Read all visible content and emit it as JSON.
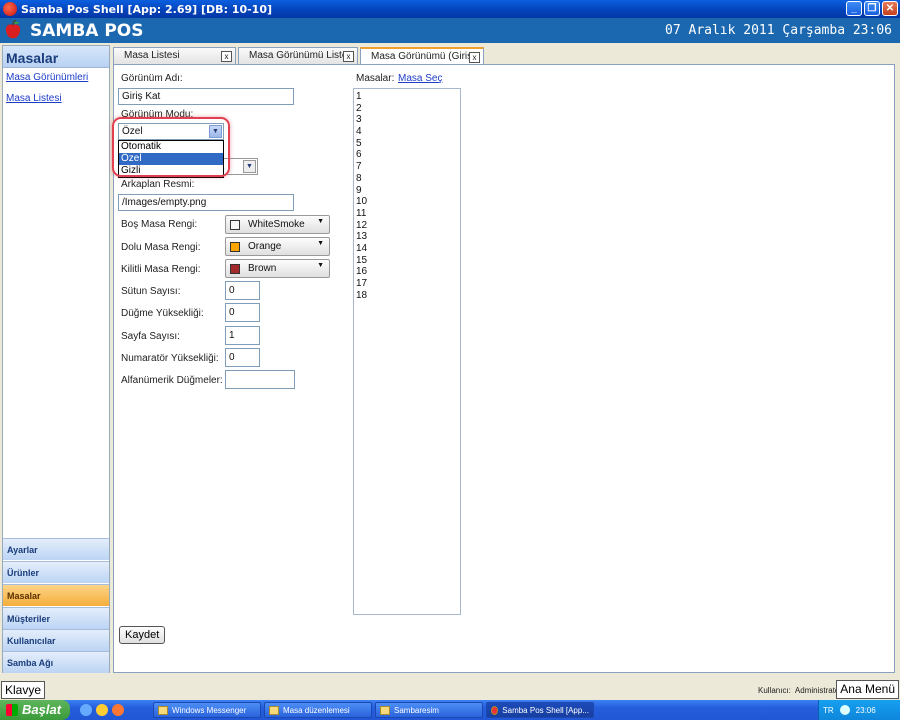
{
  "window": {
    "title": "Samba Pos Shell [App: 2.69] [DB: 10-10]",
    "minimize": "_",
    "maximize": "❐",
    "close": "✕"
  },
  "header": {
    "brand": "SAMBA POS",
    "datetime": "07 Aralık 2011 Çarşamba 23:06"
  },
  "sidebar": {
    "title": "Masalar",
    "links": [
      "Masa Görünümleri",
      "Masa Listesi"
    ],
    "nav": [
      "Ayarlar",
      "Ürünler",
      "Masalar",
      "Müşteriler",
      "Kullanıcılar",
      "Samba Ağı"
    ],
    "active_nav": "Masalar"
  },
  "tabs": [
    {
      "label": "Masa Listesi",
      "close": "x"
    },
    {
      "label": "Masa Görünümü Liste",
      "close": "x"
    },
    {
      "label": "Masa Görünümü (Giriş",
      "close": "x"
    }
  ],
  "form": {
    "gorunum_adi_label": "Görünüm Adı:",
    "gorunum_adi_value": "Giriş Kat",
    "gorunum_modu_label": "Görünüm Modu:",
    "gorunum_modu_value": "Özel",
    "gorunum_modu_options": [
      "Otomatik",
      "Özel",
      "Gizli"
    ],
    "gorunum_modu_selected": "Özel",
    "arkaplan_label": "Arkaplan Resmi:",
    "arkaplan_value": "/Images/empty.png",
    "bos_renk_label": "Boş Masa Rengi:",
    "bos_renk_value": "WhiteSmoke",
    "dolu_renk_label": "Dolu Masa Rengi:",
    "dolu_renk_value": "Orange",
    "kilitli_renk_label": "Kilitli Masa Rengi:",
    "kilitli_renk_value": "Brown",
    "sutun_label": "Sütun Sayısı:",
    "sutun_value": "0",
    "dugme_label": "Düğme Yüksekliği:",
    "dugme_value": "0",
    "sayfa_label": "Sayfa Sayısı:",
    "sayfa_value": "1",
    "numarator_label": "Numaratör Yüksekliği:",
    "numarator_value": "0",
    "alfanumerik_label": "Alfanümerik Düğmeler:",
    "alfanumerik_value": "",
    "save_label": "Kaydet"
  },
  "colors": {
    "bos": "#f5f5f5",
    "dolu": "#ffa500",
    "kilitli": "#a52a2a"
  },
  "masalar": {
    "label": "Masalar:",
    "link": "Masa Seç",
    "items": [
      "1",
      "2",
      "3",
      "4",
      "5",
      "6",
      "7",
      "8",
      "9",
      "10",
      "11",
      "12",
      "13",
      "14",
      "15",
      "16",
      "17",
      "18"
    ]
  },
  "statusbar": {
    "klavye": "Klavye",
    "user_label": "Kullanıcı:",
    "user_name": "Administrator",
    "ana_menu": "Ana Menü"
  },
  "taskbar": {
    "start": "Başlat",
    "tasks": [
      "Windows Messenger",
      "Masa düzenlemesi",
      "Sambaresim",
      "Samba Pos Shell [App..."
    ],
    "tray_lang": "TR",
    "clock": "23:06"
  }
}
